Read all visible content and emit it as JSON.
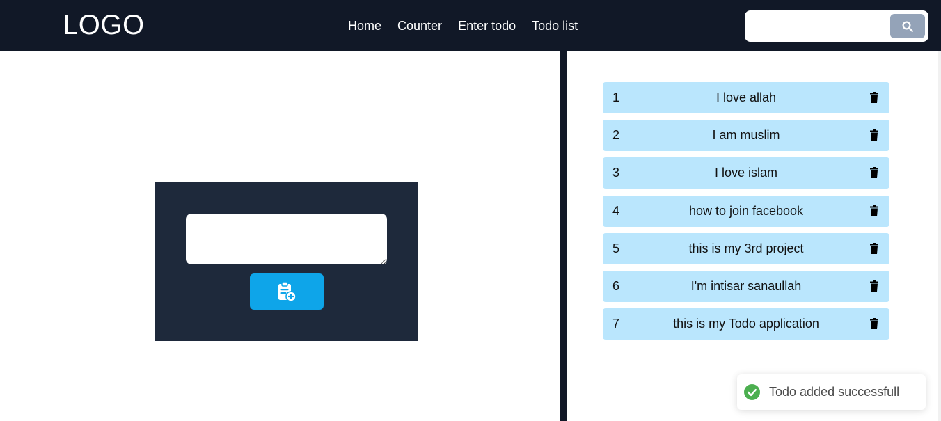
{
  "navbar": {
    "logo": "LOGO",
    "links": [
      "Home",
      "Counter",
      "Enter todo",
      "Todo list"
    ],
    "search": {
      "value": "",
      "placeholder": "",
      "button_icon": "search-icon"
    }
  },
  "form": {
    "textarea_value": "",
    "add_button_icon": "clipboard-add-icon"
  },
  "todos": [
    {
      "num": "1",
      "text": "I love allah"
    },
    {
      "num": "2",
      "text": "I am muslim"
    },
    {
      "num": "3",
      "text": "I love islam"
    },
    {
      "num": "4",
      "text": "how to join facebook"
    },
    {
      "num": "5",
      "text": "this is my 3rd project"
    },
    {
      "num": "6",
      "text": "I'm intisar sanaullah"
    },
    {
      "num": "7",
      "text": "this is my Todo application"
    }
  ],
  "toast": {
    "message": "Todo added successfull",
    "icon": "check-circle-icon"
  },
  "colors": {
    "navbar_bg": "#111827",
    "form_bg": "#1e293b",
    "add_button": "#0ea5e9",
    "todo_item_bg": "#bae6fd",
    "search_button": "#94a3b8",
    "toast_success": "#07bc0c"
  }
}
